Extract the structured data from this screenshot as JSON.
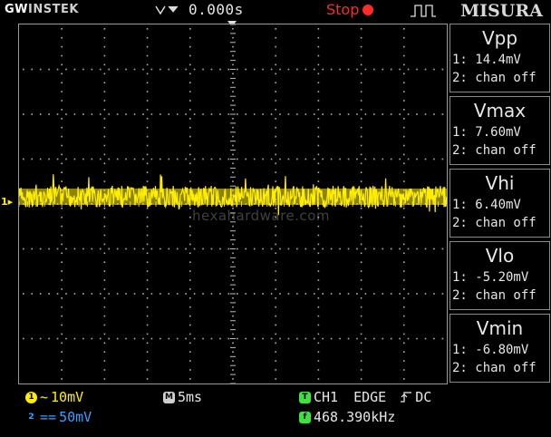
{
  "header": {
    "brand_prefix": "GW",
    "brand_name": "INSTEK",
    "trigger_delay": "0.000s",
    "run_state": "Stop",
    "menu_title": "MISURA"
  },
  "watermark": "hexahardware.com",
  "channel_marker": "1",
  "measurements": [
    {
      "title": "Vpp",
      "ch1": "1: 14.4mV",
      "ch2": "2: chan off"
    },
    {
      "title": "Vmax",
      "ch1": "1: 7.60mV",
      "ch2": "2: chan off"
    },
    {
      "title": "Vhi",
      "ch1": "1: 6.40mV",
      "ch2": "2: chan off"
    },
    {
      "title": "Vlo",
      "ch1": "1: -5.20mV",
      "ch2": "2: chan off"
    },
    {
      "title": "Vmin",
      "ch1": "1: -6.80mV",
      "ch2": "2: chan off"
    }
  ],
  "status": {
    "ch1_badge": "1",
    "ch1_coupling": "~",
    "ch1_scale": "10mV",
    "ch2_badge": "2",
    "ch2_coupling": "==",
    "ch2_scale": "50mV",
    "timebase_badge": "M",
    "timebase": "5ms",
    "trigger_badge": "T",
    "trigger_source": "CH1",
    "trigger_type": "EDGE",
    "trigger_coupling": "DC",
    "freq_badge": "f",
    "frequency": "468.390kHz"
  },
  "colors": {
    "trace": "#ffee00",
    "ch2": "#3aa0ff",
    "trigger": "#3ee23e",
    "stop": "#ff2a2a"
  }
}
